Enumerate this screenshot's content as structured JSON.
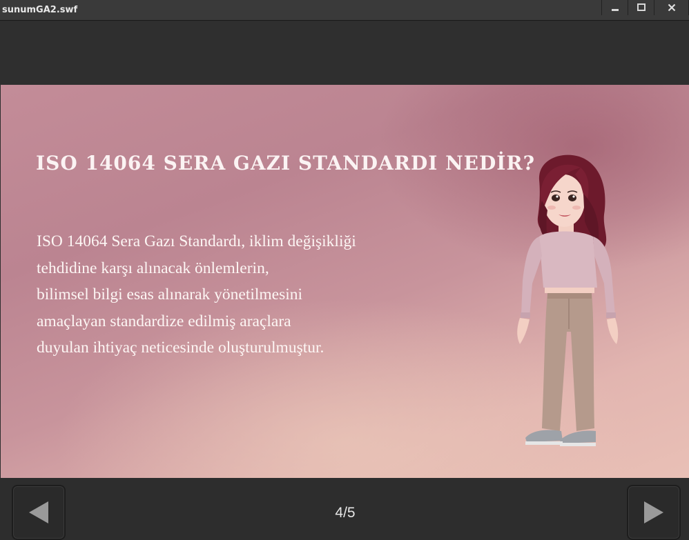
{
  "window": {
    "title": "sunumGA2.swf",
    "controls": [
      "minimize",
      "maximize",
      "close"
    ]
  },
  "slide": {
    "title": "ISO 14064 SERA GAZI STANDARDI NEDİR?",
    "body_lines": [
      "ISO 14064 Sera Gazı Standardı, iklim değişikliği",
      "tehdidine karşı alınacak önlemlerin,",
      "bilimsel bilgi esas alınarak yönetilmesini",
      "amaçlayan standardize edilmiş araçlara",
      "duyulan ihtiyaç neticesinde oluşturulmuştur."
    ]
  },
  "navigation": {
    "page_counter": "4/5",
    "prev_icon": "left-arrow-icon",
    "next_icon": "right-arrow-icon"
  },
  "colors": {
    "chrome": "#2d2d2d",
    "slide_pink": "#c38c98",
    "slide_peach": "#e9c0b6",
    "text_light": "#fdf6f4",
    "hair": "#6d1a2c",
    "shirt": "#d9b8c1",
    "pants": "#b59a8c"
  }
}
